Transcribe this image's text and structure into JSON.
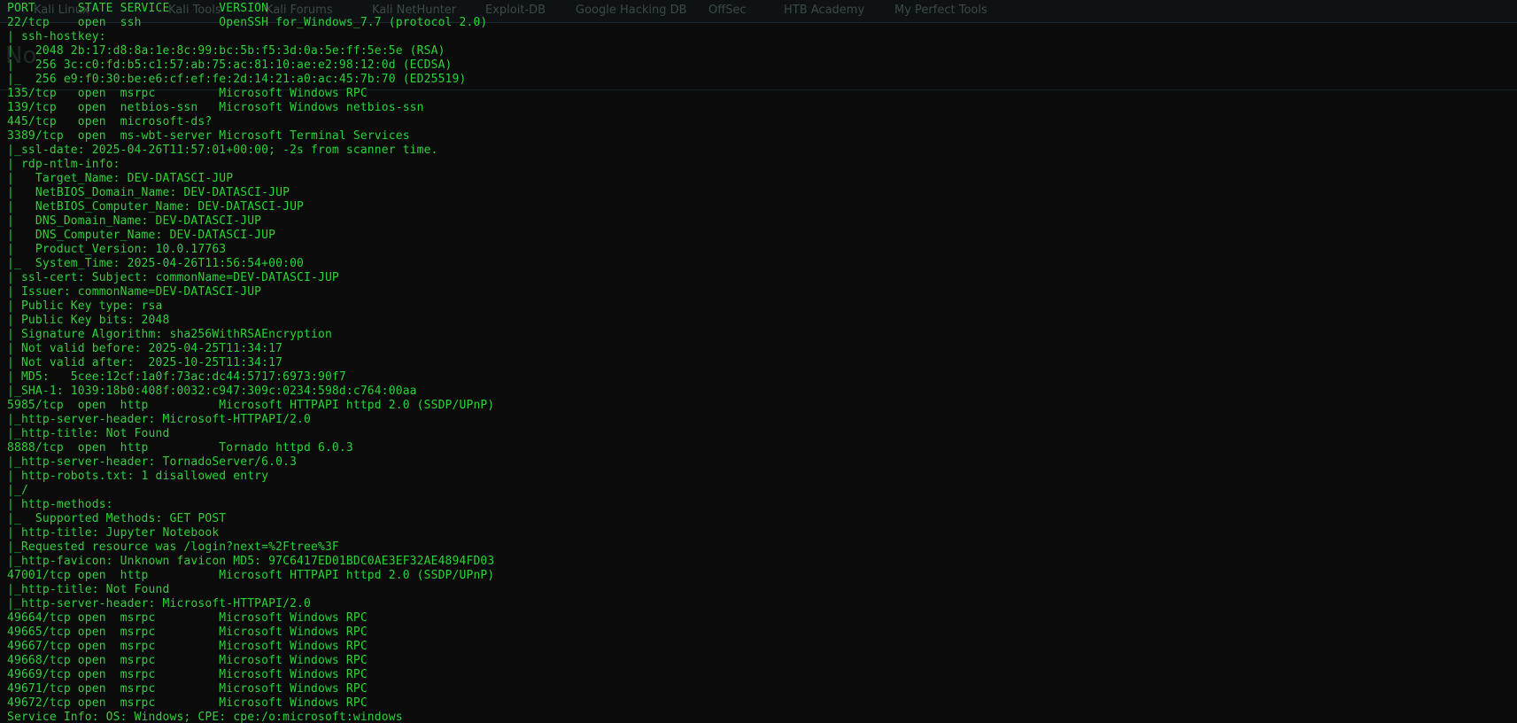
{
  "ghost_bar": {
    "items": [
      "Kali Linux",
      "Kali Tools",
      "Kali Forums",
      "Kali NetHunter",
      "Exploit-DB",
      "Google Hacking DB",
      "OffSec",
      "HTB Academy",
      "My Perfect Tools"
    ]
  },
  "ghost_heading": "No",
  "colors": {
    "text": "#2ed13a",
    "background": "#0b0b0b"
  },
  "lines": [
    "PORT      STATE SERVICE       VERSION",
    "22/tcp    open  ssh           OpenSSH for_Windows_7.7 (protocol 2.0)",
    "| ssh-hostkey: ",
    "|   2048 2b:17:d8:8a:1e:8c:99:bc:5b:f5:3d:0a:5e:ff:5e:5e (RSA)",
    "|   256 3c:c0:fd:b5:c1:57:ab:75:ac:81:10:ae:e2:98:12:0d (ECDSA)",
    "|_  256 e9:f0:30:be:e6:cf:ef:fe:2d:14:21:a0:ac:45:7b:70 (ED25519)",
    "135/tcp   open  msrpc         Microsoft Windows RPC",
    "139/tcp   open  netbios-ssn   Microsoft Windows netbios-ssn",
    "445/tcp   open  microsoft-ds?",
    "3389/tcp  open  ms-wbt-server Microsoft Terminal Services",
    "|_ssl-date: 2025-04-26T11:57:01+00:00; -2s from scanner time.",
    "| rdp-ntlm-info: ",
    "|   Target_Name: DEV-DATASCI-JUP",
    "|   NetBIOS_Domain_Name: DEV-DATASCI-JUP",
    "|   NetBIOS_Computer_Name: DEV-DATASCI-JUP",
    "|   DNS_Domain_Name: DEV-DATASCI-JUP",
    "|   DNS_Computer_Name: DEV-DATASCI-JUP",
    "|   Product_Version: 10.0.17763",
    "|_  System_Time: 2025-04-26T11:56:54+00:00",
    "| ssl-cert: Subject: commonName=DEV-DATASCI-JUP",
    "| Issuer: commonName=DEV-DATASCI-JUP",
    "| Public Key type: rsa",
    "| Public Key bits: 2048",
    "| Signature Algorithm: sha256WithRSAEncryption",
    "| Not valid before: 2025-04-25T11:34:17",
    "| Not valid after:  2025-10-25T11:34:17",
    "| MD5:   5cee:12cf:1a0f:73ac:dc44:5717:6973:90f7",
    "|_SHA-1: 1039:18b0:408f:0032:c947:309c:0234:598d:c764:00aa",
    "5985/tcp  open  http          Microsoft HTTPAPI httpd 2.0 (SSDP/UPnP)",
    "|_http-server-header: Microsoft-HTTPAPI/2.0",
    "|_http-title: Not Found",
    "8888/tcp  open  http          Tornado httpd 6.0.3",
    "|_http-server-header: TornadoServer/6.0.3",
    "| http-robots.txt: 1 disallowed entry ",
    "|_/",
    "| http-methods: ",
    "|_  Supported Methods: GET POST",
    "| http-title: Jupyter Notebook",
    "|_Requested resource was /login?next=%2Ftree%3F",
    "|_http-favicon: Unknown favicon MD5: 97C6417ED01BDC0AE3EF32AE4894FD03",
    "47001/tcp open  http          Microsoft HTTPAPI httpd 2.0 (SSDP/UPnP)",
    "|_http-title: Not Found",
    "|_http-server-header: Microsoft-HTTPAPI/2.0",
    "49664/tcp open  msrpc         Microsoft Windows RPC",
    "49665/tcp open  msrpc         Microsoft Windows RPC",
    "49667/tcp open  msrpc         Microsoft Windows RPC",
    "49668/tcp open  msrpc         Microsoft Windows RPC",
    "49669/tcp open  msrpc         Microsoft Windows RPC",
    "49671/tcp open  msrpc         Microsoft Windows RPC",
    "49672/tcp open  msrpc         Microsoft Windows RPC",
    "Service Info: OS: Windows; CPE: cpe:/o:microsoft:windows"
  ]
}
